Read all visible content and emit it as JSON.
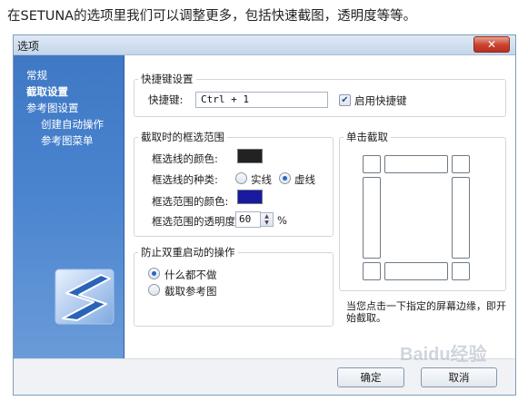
{
  "caption": "在SETUNA的选项里我们可以调整更多，包括快速截图，透明度等等。",
  "window": {
    "title": "选项",
    "close_glyph": "✕"
  },
  "sidebar": {
    "items": [
      {
        "label": "常规"
      },
      {
        "label": "截取设置"
      },
      {
        "label": "参考图设置"
      },
      {
        "label": "创建自动操作"
      },
      {
        "label": "参考图菜单"
      }
    ]
  },
  "shortcut": {
    "legend": "快捷键设置",
    "key_label": "快捷键:",
    "key_value": "Ctrl + 1",
    "enable_label": "启用快捷键",
    "enable_checked": true
  },
  "frame": {
    "legend": "截取时的框选范围",
    "line_color_label": "框选线的颜色:",
    "line_color": "#222222",
    "line_type_label": "框选线的种类:",
    "line_type_options": [
      "实线",
      "虚线"
    ],
    "line_type_selected": "虚线",
    "fill_color_label": "框选范围的颜色:",
    "fill_color": "#1a1aa0",
    "opacity_label": "框选范围的透明度:",
    "opacity_value": "60",
    "opacity_unit": "%"
  },
  "single_click": {
    "legend": "单击截取",
    "hint": "当您点击一下指定的屏幕边缘，即开始截取。"
  },
  "duplicate": {
    "legend": "防止双重启动的操作",
    "options": [
      "什么都不做",
      "截取参考图"
    ],
    "selected": "什么都不做"
  },
  "footer": {
    "ok_label": "确定",
    "cancel_label": "取消"
  },
  "icons": {
    "logo": "setuna-logo-icon",
    "checkbox": "check-icon",
    "spin": "spin-arrows-icon",
    "close": "close-icon"
  },
  "watermark": "Baidu经验"
}
